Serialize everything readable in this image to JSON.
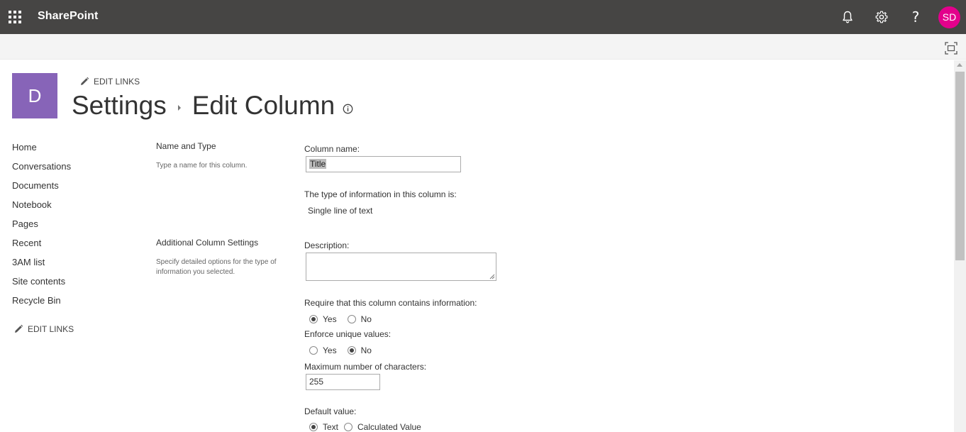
{
  "suite_bar": {
    "brand": "SharePoint",
    "avatar_initials": "SD",
    "help_glyph": "?",
    "icons": [
      "waffle-icon",
      "bell-icon",
      "gear-icon",
      "help-icon"
    ],
    "colors": {
      "bar": "#464544",
      "avatar": "#e3008c"
    }
  },
  "site": {
    "logo_letter": "D",
    "logo_color": "#8764b8",
    "edit_links": "EDIT LINKS"
  },
  "title": {
    "parent": "Settings",
    "current": "Edit Column"
  },
  "left_nav": {
    "items": [
      "Home",
      "Conversations",
      "Documents",
      "Notebook",
      "Pages",
      "Recent",
      "3AM list",
      "Site contents",
      "Recycle Bin"
    ],
    "edit_links": "EDIT LINKS"
  },
  "sections": {
    "name_type": {
      "title": "Name and Type",
      "description": "Type a name for this column."
    },
    "additional": {
      "title": "Additional Column Settings",
      "description": "Specify detailed options for the type of information you selected."
    }
  },
  "form": {
    "column_name_label": "Column name:",
    "column_name_value": "Title",
    "type_label": "The type of information in this column is:",
    "type_value": "Single line of text",
    "description_label": "Description:",
    "description_value": "",
    "require_label": "Require that this column contains information:",
    "require_options": [
      "Yes",
      "No"
    ],
    "require_selected": "Yes",
    "unique_label": "Enforce unique values:",
    "unique_options": [
      "Yes",
      "No"
    ],
    "unique_selected": "No",
    "max_chars_label": "Maximum number of characters:",
    "max_chars_value": "255",
    "default_label": "Default value:",
    "default_options": [
      "Text",
      "Calculated Value"
    ],
    "default_selected": "Text"
  }
}
